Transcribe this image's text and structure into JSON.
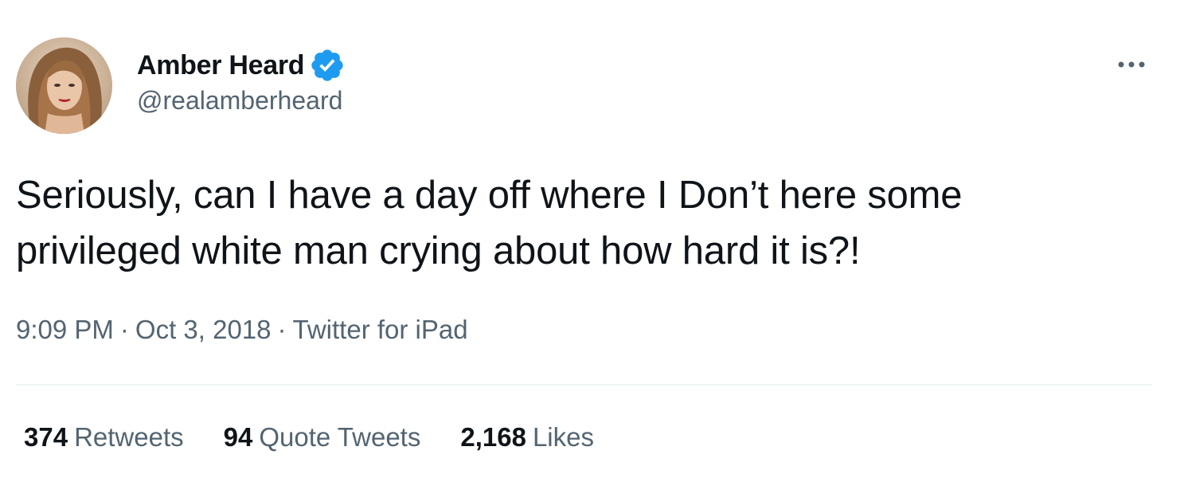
{
  "author": {
    "display_name": "Amber Heard",
    "handle": "@realamberheard",
    "verified_icon": "verified-badge-icon",
    "avatar_icon": "avatar"
  },
  "tweet": {
    "text_line_1": "Seriously, can I have a day off where I Don’t here some",
    "text_line_2": "privileged white man crying about how hard it is?!",
    "time": "9:09 PM",
    "date": "Oct 3, 2018",
    "source": "Twitter for iPad",
    "separator": "·"
  },
  "stats": {
    "retweets_count": "374",
    "retweets_label": "Retweets",
    "quotes_count": "94",
    "quotes_label": "Quote Tweets",
    "likes_count": "2,168",
    "likes_label": "Likes"
  },
  "more_icon": "more-options-icon",
  "colors": {
    "text_primary": "#0f1419",
    "text_secondary": "#536471",
    "verified_blue": "#1d9bf0",
    "divider": "#eff3f4"
  }
}
